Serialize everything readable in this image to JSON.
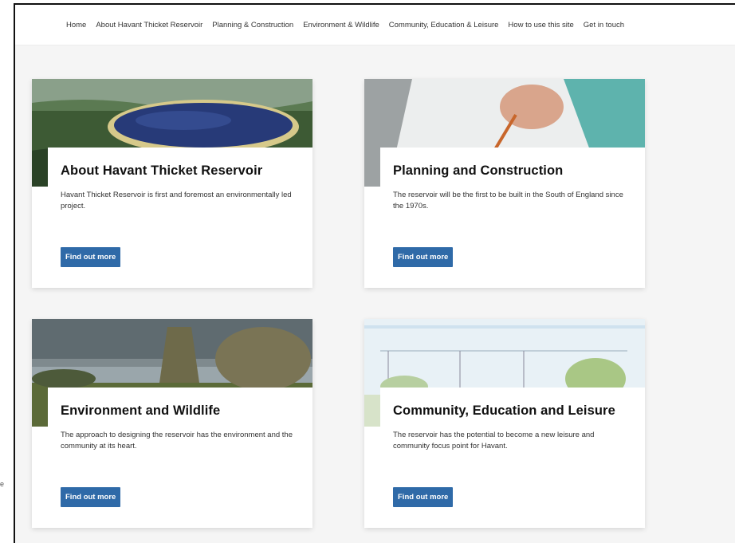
{
  "nav": {
    "items": [
      "Home",
      "About Havant Thicket Reservoir",
      "Planning & Construction",
      "Environment & Wildlife",
      "Community, Education & Leisure",
      "How to use this site",
      "Get in touch"
    ]
  },
  "cards": [
    {
      "title": "About Havant Thicket Reservoir",
      "description": "Havant Thicket Reservoir is first and foremost an environmentally led project.",
      "button": "Find out more"
    },
    {
      "title": "Planning and Construction",
      "description": "The reservoir will be the first to be built in the South of England since the 1970s.",
      "button": "Find out more"
    },
    {
      "title": "Environment and Wildlife",
      "description": "The approach to designing the reservoir has the environment and the community at its heart.",
      "button": "Find out more"
    },
    {
      "title": "Community, Education and Leisure",
      "description": "The reservoir has the potential to become a new leisure and community focus point for Havant.",
      "button": "Find out more"
    }
  ],
  "stray_mark": "e",
  "colors": {
    "button": "#2f6aa8",
    "page_bg": "#f5f5f5"
  }
}
